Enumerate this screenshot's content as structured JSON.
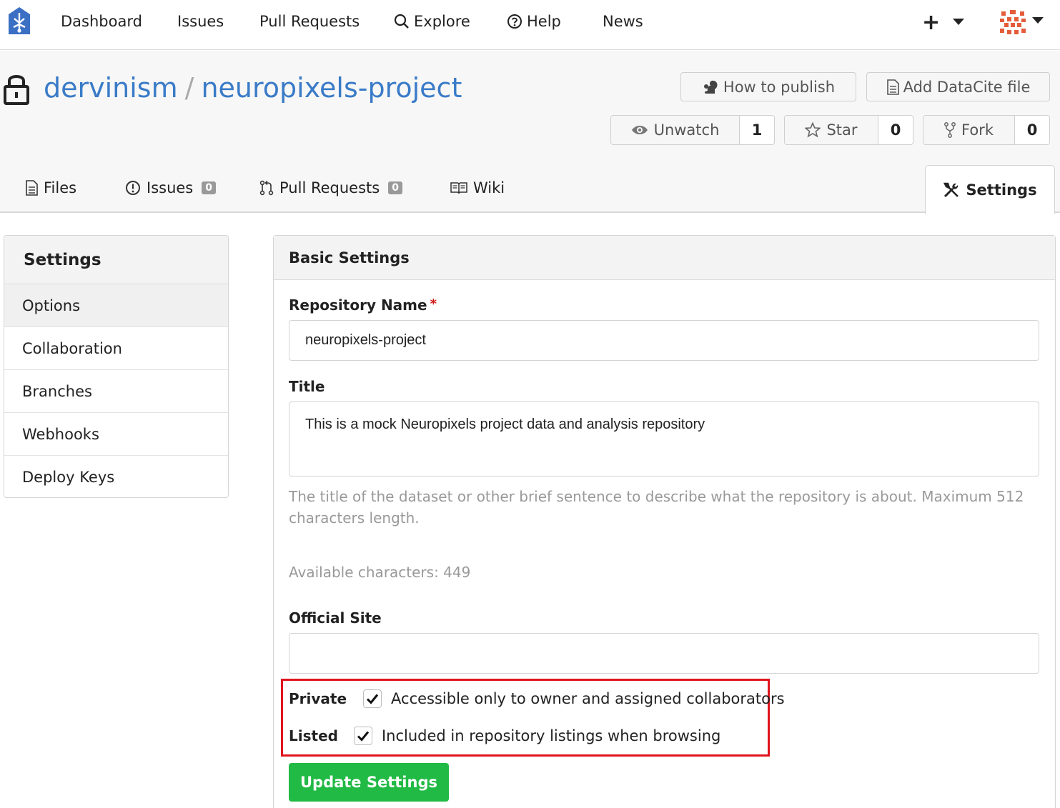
{
  "nav": {
    "items": [
      "Dashboard",
      "Issues",
      "Pull Requests",
      "Explore",
      "Help",
      "News"
    ],
    "plus": "+"
  },
  "repo": {
    "owner": "dervinism",
    "separator": "/",
    "name": "neuropixels-project",
    "private": true
  },
  "header_buttons": {
    "how_to_publish": "How to publish",
    "add_datacite": "Add DataCite file",
    "unwatch_label": "Unwatch",
    "unwatch_count": "1",
    "star_label": "Star",
    "star_count": "0",
    "fork_label": "Fork",
    "fork_count": "0"
  },
  "tabs": {
    "files": "Files",
    "issues": "Issues",
    "issues_count": "0",
    "pulls": "Pull Requests",
    "pulls_count": "0",
    "wiki": "Wiki",
    "settings": "Settings"
  },
  "sidebar": {
    "title": "Settings",
    "items": [
      "Options",
      "Collaboration",
      "Branches",
      "Webhooks",
      "Deploy Keys"
    ],
    "active": "Options"
  },
  "form": {
    "section_title": "Basic Settings",
    "repo_name_label": "Repository Name",
    "required_mark": "*",
    "repo_name_value": "neuropixels-project",
    "title_label": "Title",
    "title_value": "This is a mock Neuropixels project data and analysis repository",
    "title_help": "The title of the dataset or other brief sentence to describe what the repository is about. Maximum 512 characters length.",
    "available_chars": "Available characters: 449",
    "official_site_label": "Official Site",
    "official_site_value": "",
    "private_label": "Private",
    "private_text": "Accessible only to owner and assigned collaborators",
    "private_checked": true,
    "listed_label": "Listed",
    "listed_text": "Included in repository listings when browsing",
    "listed_checked": true,
    "update_button": "Update Settings"
  },
  "colors": {
    "link": "#3a7bc8",
    "primary_button": "#21ba45",
    "highlight_border": "#e0141e",
    "required": "#d01919"
  },
  "icons": {
    "logo": "gin-logo-icon",
    "explore": "search-icon",
    "help": "question-circle-icon",
    "lock": "lock-icon",
    "how_to_publish": "squirrel-icon",
    "add_datacite": "file-icon",
    "unwatch": "eye-icon",
    "star": "star-icon",
    "fork": "fork-icon",
    "files": "file-text-icon",
    "issues": "issue-icon",
    "pulls": "pull-request-icon",
    "wiki": "book-icon",
    "settings": "tools-icon",
    "checkbox": "checkmark-icon"
  }
}
